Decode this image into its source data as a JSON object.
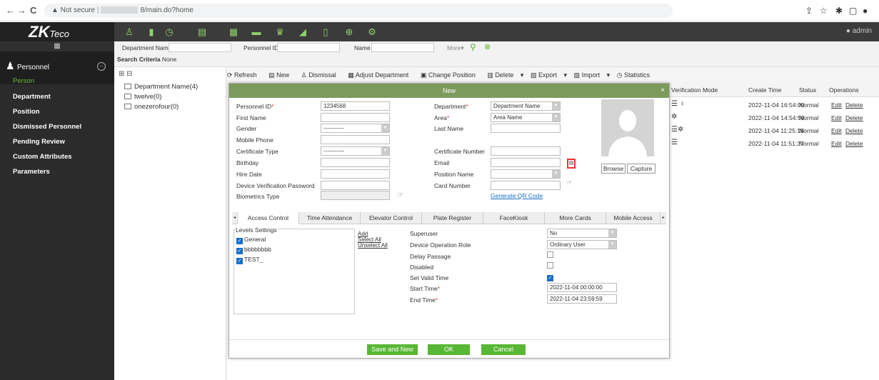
{
  "browser": {
    "back": "←",
    "forward": "→",
    "reload": "C",
    "security_label": "Not secure",
    "url_path": "8/main.do?home"
  },
  "app": {
    "logo_main": "ZK",
    "logo_sub": "Teco",
    "admin_label": "admin"
  },
  "sidebar": {
    "module": "Personnel",
    "items": [
      {
        "label": "Person",
        "active": true
      },
      {
        "label": "Department"
      },
      {
        "label": "Position"
      },
      {
        "label": "Dismissed Personnel"
      },
      {
        "label": "Pending Review"
      },
      {
        "label": "Custom Attributes"
      },
      {
        "label": "Parameters"
      }
    ]
  },
  "criteria": {
    "department_name": "Department Name",
    "personnel_id": "Personnel ID",
    "name": "Name",
    "more": "More",
    "search_criteria": "Search Criteria",
    "none": "None"
  },
  "tree": {
    "nodes": [
      "Department Name(4)",
      "twelve(0)",
      "onezerofour(0)"
    ]
  },
  "toolbar": {
    "refresh": "Refresh",
    "new": "New",
    "dismissal": "Dismissal",
    "adjust_department": "Adjust Department",
    "change_position": "Change Position",
    "delete": "Delete",
    "export": "Export",
    "import": "Import",
    "statistics": "Statistics"
  },
  "grid": {
    "headers": [
      "Verification Mode",
      "Create Time",
      "Status",
      "Operations"
    ],
    "rows": [
      {
        "create_time": "2022-11-04 16:54:00",
        "status": "Normal"
      },
      {
        "create_time": "2022-11-04 14:54:59",
        "status": "Normal"
      },
      {
        "create_time": "2022-11-04 11:25:18",
        "status": "Normal"
      },
      {
        "create_time": "2022-11-04 11:51:37",
        "status": "Normal"
      }
    ],
    "edit": "Edit",
    "delete": "Delete"
  },
  "dialog": {
    "title": "New",
    "close": "×",
    "personnel_id_label": "Personnel ID",
    "personnel_id_value": "1234568",
    "department_label": "Department",
    "department_value": "Department Name",
    "first_name_label": "First Name",
    "area_label": "Area",
    "area_value": "Area Name",
    "gender_label": "Gender",
    "gender_value": "-----------",
    "last_name_label": "Last Name",
    "mobile_phone_label": "Mobile Phone",
    "certificate_type_label": "Certificate Type",
    "certificate_type_value": "-----------",
    "certificate_number_label": "Certificate Number",
    "birthday_label": "Birthday",
    "email_label": "Email",
    "hire_date_label": "Hire Date",
    "position_name_label": "Position Name",
    "device_pwd_label": "Device Verification Password",
    "card_number_label": "Card Number",
    "biometrics_label": "Biometrics Type",
    "generate_qr": "Generate QR Code",
    "browse": "Browse",
    "capture": "Capture",
    "tabs": [
      "Access Control",
      "Time Attendance",
      "Elevator Control",
      "Plate Register",
      "FaceKiosk",
      "More Cards",
      "Mobile Access"
    ],
    "levels_title": "Levels Settings",
    "levels": [
      "General",
      "bbbbbbbb",
      "TEST_"
    ],
    "add": "Add",
    "select_all": "Select All",
    "unselect_all": "Unselect All",
    "superuser_label": "Superuser",
    "superuser_value": "No",
    "device_role_label": "Device Operation Role",
    "device_role_value": "Ordinary User",
    "delay_passage_label": "Delay Passage",
    "disabled_label": "Disabled",
    "set_valid_time_label": "Set Valid Time",
    "start_time_label": "Start Time",
    "start_time_value": "2022-11-04 00:00:00",
    "end_time_label": "End Time",
    "end_time_value": "2022-11-04 23:59:59",
    "save_and_new": "Save and New",
    "ok": "OK",
    "cancel": "Cancel"
  },
  "colors": {
    "accent_green": "#58b734",
    "title_green": "#7d9a5d",
    "icon_green": "#8fd16a",
    "sidebar_active": "#6dbb3c"
  }
}
